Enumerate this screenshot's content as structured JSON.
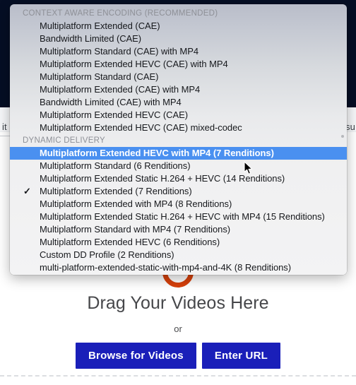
{
  "background": {
    "left_fragment": "it",
    "right_fragment": "su"
  },
  "dropzone": {
    "logo_name": "brand-logo-mark",
    "title": "Drag Your Videos Here",
    "or_label": "or",
    "browse_button": "Browse for Videos",
    "url_button": "Enter URL",
    "button_color": "#1a1fb9"
  },
  "menu": {
    "selected_color": "#4a90f0",
    "checked_item_index": 3,
    "highlighted_item_index": 0,
    "sections": [
      {
        "header": "CONTEXT AWARE ENCODING (RECOMMENDED)",
        "items": [
          "Multiplatform Extended (CAE)",
          "Bandwidth Limited (CAE)",
          "Multiplatform Standard (CAE) with MP4",
          "Multiplatform Extended HEVC (CAE) with MP4",
          "Multiplatform Standard (CAE)",
          "Multiplatform Extended (CAE) with MP4",
          "Bandwidth Limited (CAE) with MP4",
          "Multiplatform Extended HEVC (CAE)",
          "Multiplatform Extended HEVC (CAE) mixed-codec"
        ]
      },
      {
        "header": "DYNAMIC DELIVERY",
        "items": [
          "Multiplatform Extended HEVC with MP4 (7 Renditions)",
          "Multiplatform Standard (6 Renditions)",
          "Multiplatform Extended Static H.264 + HEVC (14 Renditions)",
          "Multiplatform Extended (7 Renditions)",
          "Multiplatform Extended with MP4 (8 Renditions)",
          "Multiplatform Extended Static H.264 + HEVC with MP4 (15 Renditions)",
          "Multiplatform Standard with MP4 (7 Renditions)",
          "Multiplatform Extended HEVC (6 Renditions)",
          "Custom DD Profile (2 Renditions)",
          "multi-platform-extended-static-with-mp4-and-4K (8 Renditions)"
        ]
      }
    ],
    "checkmark_glyph": "✓"
  }
}
